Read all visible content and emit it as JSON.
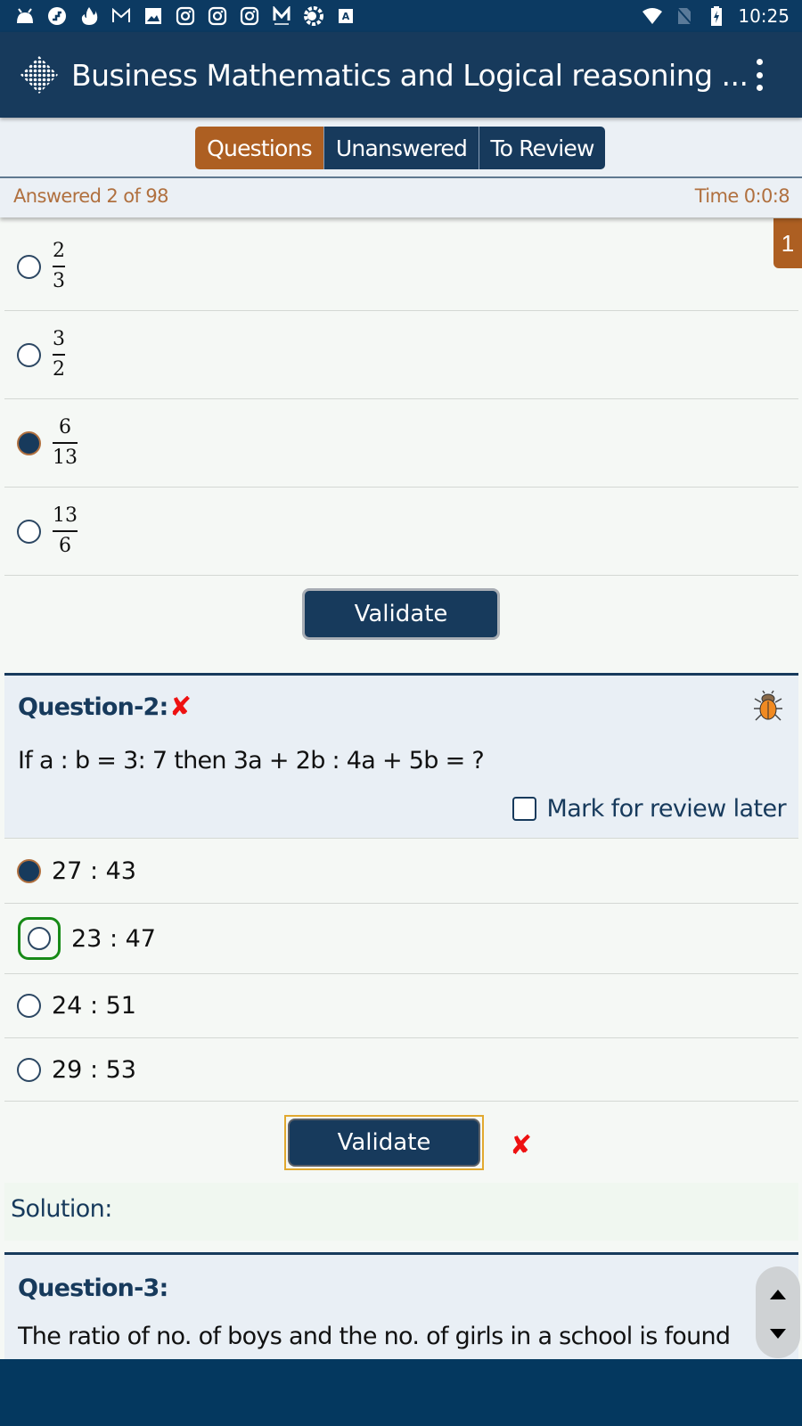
{
  "status_bar": {
    "notification_icons": [
      "android-icon",
      "stairs-app-icon",
      "fire-icon",
      "gmail-icon",
      "image-icon",
      "instagram-icon",
      "instagram-icon",
      "instagram-icon",
      "medium-icon",
      "loader-app-icon",
      "text-app-icon"
    ],
    "system_icons": [
      "wifi-icon",
      "no-sim-icon",
      "battery-charging-icon"
    ],
    "time": "10:25"
  },
  "app_bar": {
    "title": "Business Mathematics and Logical reasoning ...",
    "menu_icon": "overflow-menu-icon"
  },
  "tabs": [
    {
      "label": "Questions",
      "active": true
    },
    {
      "label": "Unanswered",
      "active": false
    },
    {
      "label": "To Review",
      "active": false
    }
  ],
  "progress": {
    "answered": "Answered 2 of 98",
    "time": "Time 0:0:8"
  },
  "page_badge": "1",
  "question_1": {
    "options": [
      {
        "numerator": "2",
        "denominator": "3",
        "selected": false
      },
      {
        "numerator": "3",
        "denominator": "2",
        "selected": false
      },
      {
        "numerator": "6",
        "denominator": "13",
        "selected": true
      },
      {
        "numerator": "13",
        "denominator": "6",
        "selected": false
      }
    ],
    "validate_label": "Validate"
  },
  "question_2": {
    "title": "Question-2:",
    "result_mark": "✘",
    "report_icon": "bug-icon",
    "text": "If a : b = 3: 7 then 3a + 2b : 4a + 5b = ?",
    "review_label": "Mark for review later",
    "review_checked": false,
    "options": [
      {
        "label": "27 : 43",
        "selected": true,
        "correct": false
      },
      {
        "label": "23 : 47",
        "selected": false,
        "correct": true
      },
      {
        "label": "24 : 51",
        "selected": false,
        "correct": false
      },
      {
        "label": "29 : 53",
        "selected": false,
        "correct": false
      }
    ],
    "validate_label": "Validate",
    "validate_result": "✘",
    "solution_label": "Solution:"
  },
  "question_3": {
    "title": "Question-3:",
    "text": "The ratio of no. of boys and the no. of girls in a school is found"
  },
  "colors": {
    "primary": "#173a5c",
    "accent": "#ad5f22",
    "correct": "#178a17",
    "wrong": "#ee1111"
  }
}
